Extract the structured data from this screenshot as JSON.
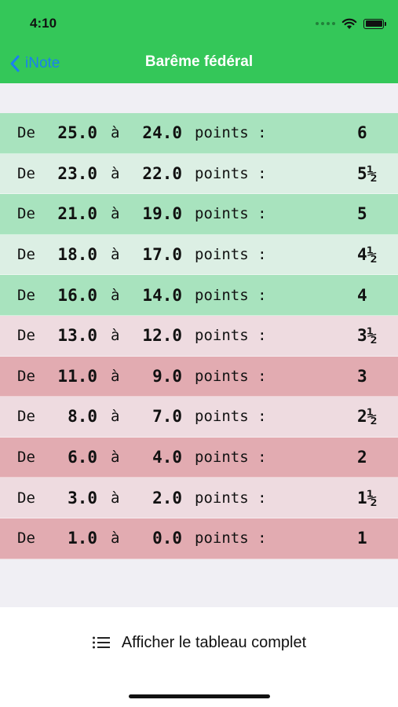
{
  "status_bar": {
    "time": "4:10"
  },
  "nav": {
    "back_label": "iNote",
    "title": "Barême fédéral"
  },
  "colors": {
    "nav_bar": "#34c759",
    "back": "#1a7ff0",
    "pass_dark": "#a8e3be",
    "pass_light": "#dcefe4",
    "fail_dark": "#e2abb1",
    "fail_light": "#eedbe0"
  },
  "table": {
    "rows": [
      {
        "de": "De",
        "from": "25.0",
        "a": "à",
        "to": "24.0",
        "points": "points :",
        "grade": "6",
        "tone": "pass_dark"
      },
      {
        "de": "De",
        "from": "23.0",
        "a": "à",
        "to": "22.0",
        "points": "points :",
        "grade": "5½",
        "tone": "pass_light"
      },
      {
        "de": "De",
        "from": "21.0",
        "a": "à",
        "to": "19.0",
        "points": "points :",
        "grade": "5",
        "tone": "pass_dark"
      },
      {
        "de": "De",
        "from": "18.0",
        "a": "à",
        "to": "17.0",
        "points": "points :",
        "grade": "4½",
        "tone": "pass_light"
      },
      {
        "de": "De",
        "from": "16.0",
        "a": "à",
        "to": "14.0",
        "points": "points :",
        "grade": "4",
        "tone": "pass_dark"
      },
      {
        "de": "De",
        "from": "13.0",
        "a": "à",
        "to": "12.0",
        "points": "points :",
        "grade": "3½",
        "tone": "fail_light"
      },
      {
        "de": "De",
        "from": "11.0",
        "a": "à",
        "to": "9.0",
        "points": "points :",
        "grade": "3",
        "tone": "fail_dark"
      },
      {
        "de": "De",
        "from": "8.0",
        "a": "à",
        "to": "7.0",
        "points": "points :",
        "grade": "2½",
        "tone": "fail_light"
      },
      {
        "de": "De",
        "from": "6.0",
        "a": "à",
        "to": "4.0",
        "points": "points :",
        "grade": "2",
        "tone": "fail_dark"
      },
      {
        "de": "De",
        "from": "3.0",
        "a": "à",
        "to": "2.0",
        "points": "points :",
        "grade": "1½",
        "tone": "fail_light"
      },
      {
        "de": "De",
        "from": "1.0",
        "a": "à",
        "to": "0.0",
        "points": "points :",
        "grade": "1",
        "tone": "fail_dark"
      }
    ]
  },
  "footer": {
    "full_table_label": "Afficher le tableau complet",
    "icon": "list-icon"
  }
}
